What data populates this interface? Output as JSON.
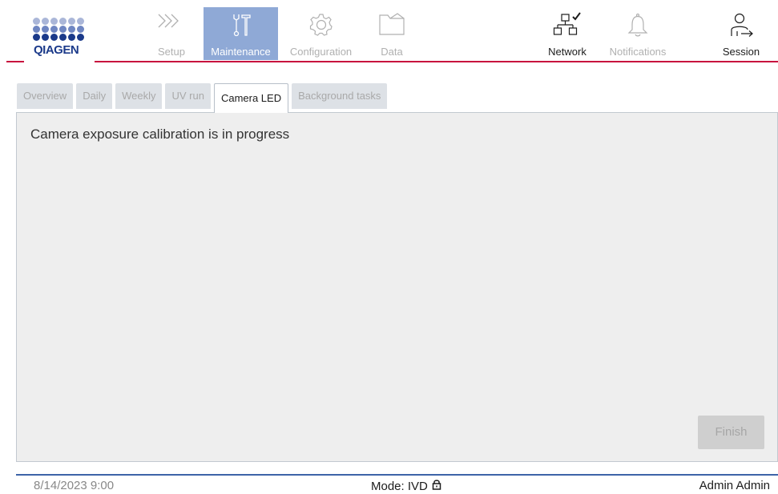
{
  "header": {
    "logo_text": "QIAGEN",
    "nav": [
      {
        "label": "Setup",
        "icon": "chevrons-right-icon",
        "state": "disabled"
      },
      {
        "label": "Maintenance",
        "icon": "tools-icon",
        "state": "active"
      },
      {
        "label": "Configuration",
        "icon": "gear-icon",
        "state": "disabled"
      },
      {
        "label": "Data",
        "icon": "folder-icon",
        "state": "disabled"
      }
    ],
    "right": [
      {
        "label": "Network",
        "icon": "network-check-icon",
        "state": "enabled"
      },
      {
        "label": "Notifications",
        "icon": "bell-icon",
        "state": "disabled"
      },
      {
        "label": "Session",
        "icon": "user-logout-icon",
        "state": "enabled"
      }
    ]
  },
  "tabs": [
    {
      "label": "Overview",
      "active": false
    },
    {
      "label": "Daily",
      "active": false
    },
    {
      "label": "Weekly",
      "active": false
    },
    {
      "label": "UV run",
      "active": false
    },
    {
      "label": "Camera LED",
      "active": true
    },
    {
      "label": "Background tasks",
      "active": false
    }
  ],
  "panel": {
    "message": "Camera exposure calibration is in progress",
    "finish_label": "Finish"
  },
  "footer": {
    "datetime": "8/14/2023 9:00",
    "mode": "Mode: IVD",
    "user": "Admin Admin"
  },
  "colors": {
    "accent_red": "#c8103e",
    "active_nav": "#8fa9d6",
    "footer_line": "#3d64a8",
    "logo_blue": "#1b3a8a"
  }
}
